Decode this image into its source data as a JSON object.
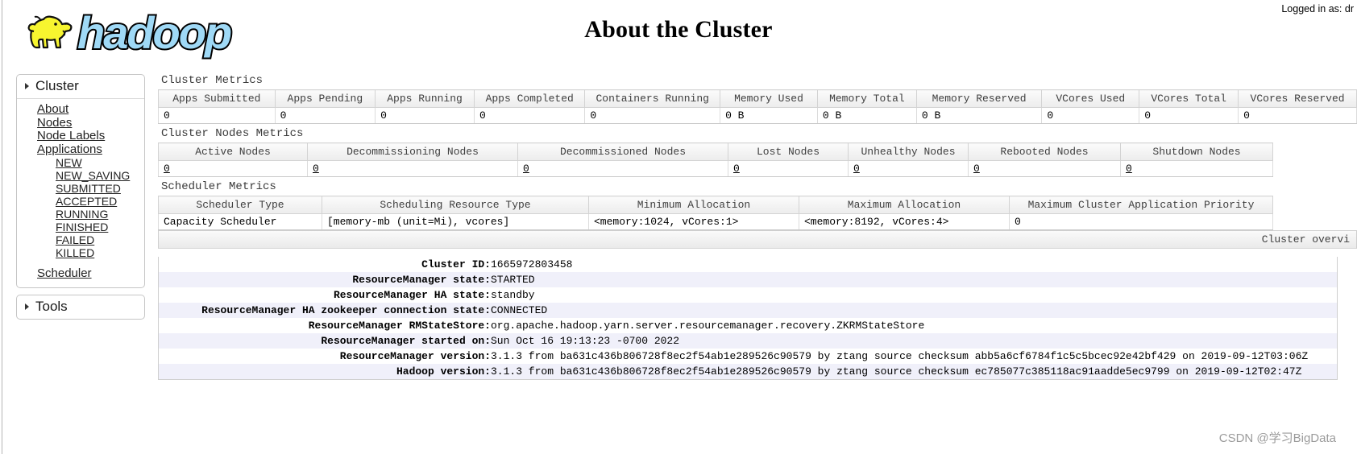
{
  "header": {
    "title": "About the Cluster",
    "logo_text": "hadoop",
    "login_info": "Logged in as: dr"
  },
  "sidebar": {
    "cluster": {
      "label": "Cluster",
      "items": [
        {
          "label": "About"
        },
        {
          "label": "Nodes"
        },
        {
          "label": "Node Labels"
        },
        {
          "label": "Applications"
        }
      ],
      "app_states": [
        {
          "label": "NEW"
        },
        {
          "label": "NEW_SAVING"
        },
        {
          "label": "SUBMITTED"
        },
        {
          "label": "ACCEPTED"
        },
        {
          "label": "RUNNING"
        },
        {
          "label": "FINISHED"
        },
        {
          "label": "FAILED"
        },
        {
          "label": "KILLED"
        }
      ],
      "scheduler": {
        "label": "Scheduler"
      }
    },
    "tools": {
      "label": "Tools"
    }
  },
  "cluster_metrics": {
    "title": "Cluster Metrics",
    "columns": [
      "Apps Submitted",
      "Apps Pending",
      "Apps Running",
      "Apps Completed",
      "Containers Running",
      "Memory Used",
      "Memory Total",
      "Memory Reserved",
      "VCores Used",
      "VCores Total",
      "VCores Reserved"
    ],
    "values": [
      "0",
      "0",
      "0",
      "0",
      "0",
      "0 B",
      "0 B",
      "0 B",
      "0",
      "0",
      "0"
    ]
  },
  "cluster_nodes_metrics": {
    "title": "Cluster Nodes Metrics",
    "columns": [
      "Active Nodes",
      "Decommissioning Nodes",
      "Decommissioned Nodes",
      "Lost Nodes",
      "Unhealthy Nodes",
      "Rebooted Nodes",
      "Shutdown Nodes"
    ],
    "values": [
      "0",
      "0",
      "0",
      "0",
      "0",
      "0",
      "0"
    ]
  },
  "scheduler_metrics": {
    "title": "Scheduler Metrics",
    "columns": [
      "Scheduler Type",
      "Scheduling Resource Type",
      "Minimum Allocation",
      "Maximum Allocation",
      "Maximum Cluster Application Priority"
    ],
    "values": [
      "Capacity Scheduler",
      "[memory-mb (unit=Mi), vcores]",
      "<memory:1024, vCores:1>",
      "<memory:8192, vCores:4>",
      "0"
    ]
  },
  "about_table": {
    "caption": "Cluster overvi",
    "rows": [
      {
        "key": "Cluster ID:",
        "value": "1665972803458"
      },
      {
        "key": "ResourceManager state:",
        "value": "STARTED"
      },
      {
        "key": "ResourceManager HA state:",
        "value": "standby"
      },
      {
        "key": "ResourceManager HA zookeeper connection state:",
        "value": "CONNECTED"
      },
      {
        "key": "ResourceManager RMStateStore:",
        "value": "org.apache.hadoop.yarn.server.resourcemanager.recovery.ZKRMStateStore"
      },
      {
        "key": "ResourceManager started on:",
        "value": "Sun Oct 16 19:13:23 -0700 2022"
      },
      {
        "key": "ResourceManager version:",
        "value": "3.1.3 from ba631c436b806728f8ec2f54ab1e289526c90579 by ztang source checksum abb5a6cf6784f1c5c5bcec92e42bf429 on 2019-09-12T03:06Z"
      },
      {
        "key": "Hadoop version:",
        "value": "3.1.3 from ba631c436b806728f8ec2f54ab1e289526c90579 by ztang source checksum ec785077c385118ac91aadde5ec9799 on 2019-09-12T02:47Z"
      }
    ]
  },
  "watermark": "CSDN @学习BigData"
}
